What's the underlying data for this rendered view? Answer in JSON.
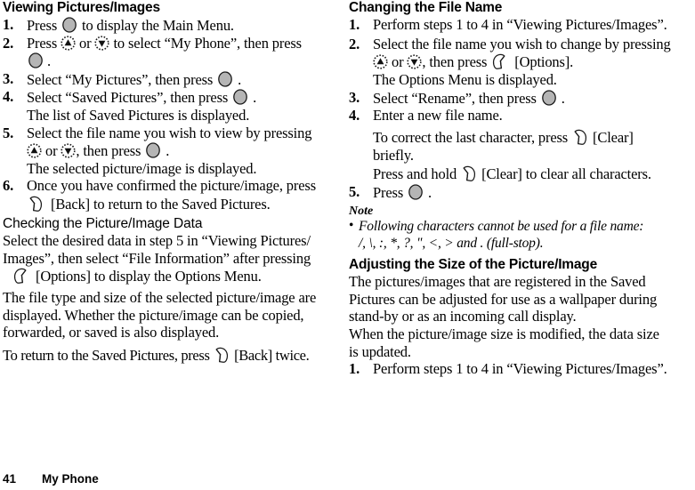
{
  "footer": {
    "page_number": "41",
    "chapter": "My Phone"
  },
  "left_column": {
    "section1": {
      "heading": "Viewing Pictures/Images",
      "steps": [
        {
          "num": "1.",
          "parts": [
            "Press ",
            "[center-key]",
            " to display the Main Menu."
          ]
        },
        {
          "num": "2.",
          "parts": [
            "Press ",
            "[nav-up-key]",
            " or ",
            "[nav-down-key]",
            " to select “My Phone”, then press"
          ],
          "cont": [
            "[center-key]",
            "."
          ]
        },
        {
          "num": "3.",
          "parts": [
            "Select “My Pictures”, then press ",
            "[center-key]",
            " ."
          ]
        },
        {
          "num": "4.",
          "parts": [
            "Select “Saved Pictures”, then press ",
            "[center-key]",
            " ."
          ],
          "result": "The list of Saved Pictures is displayed."
        },
        {
          "num": "5.",
          "parts": [
            "Select the file name you wish to view by pressing"
          ],
          "cont": [
            "[nav-up-key]",
            " or ",
            "[nav-down-key]",
            ", then press ",
            "[center-key]",
            " ."
          ],
          "result": "The selected picture/image is displayed."
        },
        {
          "num": "6.",
          "parts": [
            "Once you have confirmed the picture/image, press"
          ],
          "cont": [
            "[softkey-right]",
            " [Back] to return to the Saved Pictures."
          ]
        }
      ]
    },
    "section2": {
      "heading": "Checking the Picture/Image Data",
      "line1": "Select the desired data in step 5 in “Viewing Pictures/",
      "line2": "Images”, then select “File Information” after pressing",
      "line3_after_icon": " [Options] to display the Options Menu.",
      "para2_line1": "The file type and size of the selected picture/image are",
      "para2_line2": "displayed. Whether the picture/image can be copied,",
      "para2_line3": "forwarded, or saved is also displayed.",
      "para3_before_icon": "To return to the Saved Pictures, press ",
      "para3_after_icon": " [Back] twice."
    }
  },
  "right_column": {
    "section1": {
      "heading": "Changing the File Name",
      "steps": [
        {
          "num": "1.",
          "text": "Perform steps 1 to 4 in “Viewing Pictures/Images”."
        },
        {
          "num": "2.",
          "parts": [
            "Select the file name you wish to change by pressing"
          ],
          "cont": [
            "[nav-up-key]",
            " or ",
            "[nav-down-key]",
            ", then press ",
            "[softkey-left]",
            " [Options]."
          ],
          "result": "The Options Menu is displayed."
        },
        {
          "num": "3.",
          "parts": [
            "Select “Rename”, then press ",
            "[center-key]",
            " ."
          ]
        },
        {
          "num": "4.",
          "parts": [
            "Enter a new file name."
          ],
          "sub1_before": "To correct the last character, press ",
          "sub1_after": " [Clear]",
          "sub1_line2": "briefly.",
          "sub2_before": "Press and hold ",
          "sub2_after": " [Clear] to clear all characters."
        },
        {
          "num": "5.",
          "parts": [
            "Press ",
            "[center-key]",
            " ."
          ]
        }
      ]
    },
    "note": {
      "heading": "Note",
      "bullet": "•",
      "line1": "Following characters cannot be used for a file name:",
      "line2": "/, \\, :, *, ?, \", <, > and . (full-stop)."
    },
    "section2": {
      "heading": "Adjusting the Size of the Picture/Image",
      "para1_line1": "The pictures/images that are registered in the Saved",
      "para1_line2": "Pictures can be adjusted for use as a wallpaper during",
      "para1_line3": "stand-by or as an incoming call display.",
      "para2_line1": "When the picture/image size is modified, the data size",
      "para2_line2": "is updated.",
      "step1_num": "1.",
      "step1_text": "Perform steps 1 to 4 in “Viewing Pictures/Images”."
    }
  },
  "icons": {
    "center_key": "center-select-key-icon",
    "nav_up_key": "navigation-up-key-icon",
    "nav_down_key": "navigation-down-key-icon",
    "softkey_left": "left-softkey-icon",
    "softkey_right": "right-softkey-icon"
  },
  "colors": {
    "key_fill": "#b5b5b5",
    "key_stroke": "#1a1a1a",
    "text": "#000000",
    "background": "#ffffff"
  }
}
